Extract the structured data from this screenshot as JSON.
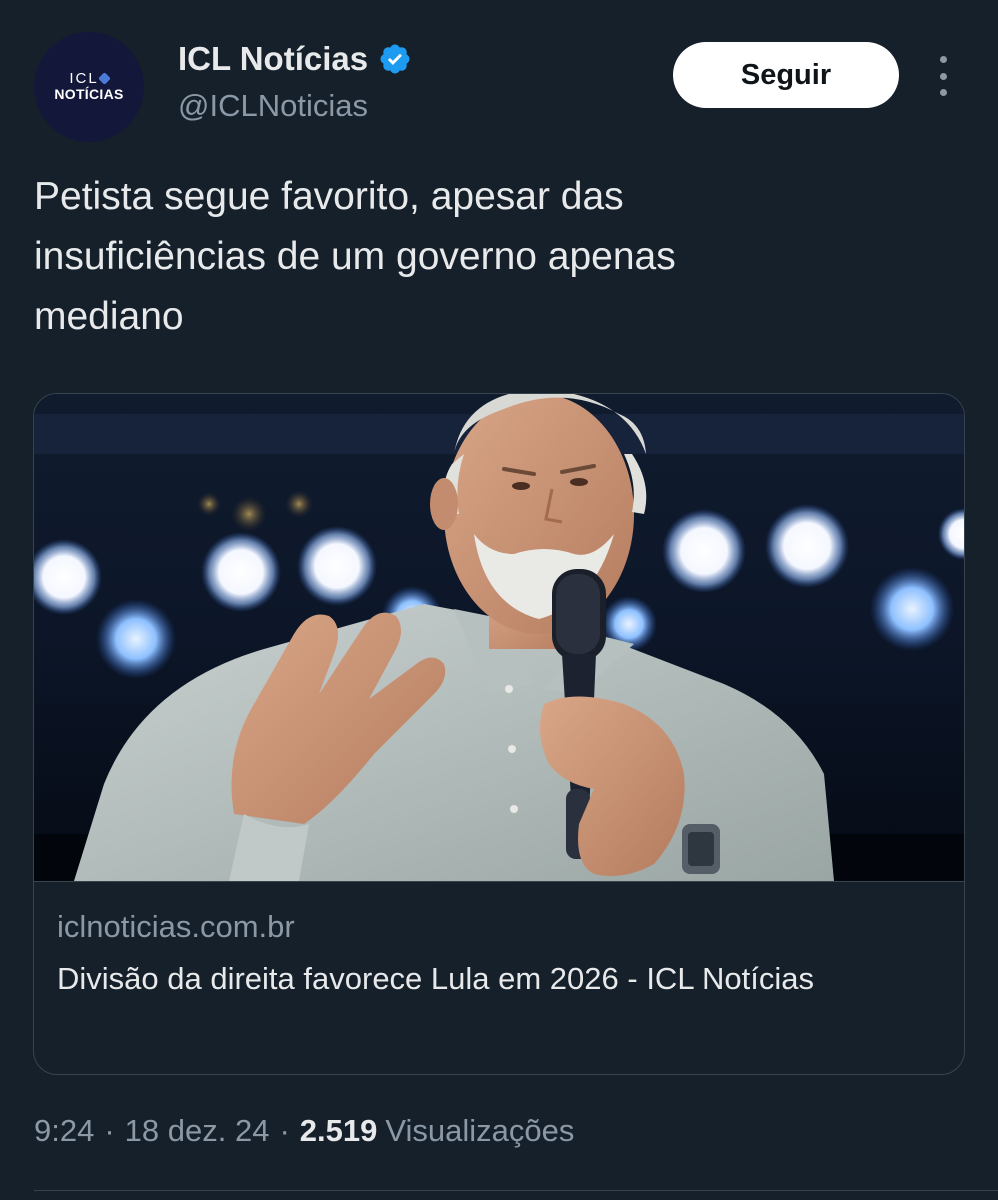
{
  "account": {
    "avatar_logo_top": "ICL",
    "avatar_logo_bottom": "NOTÍCIAS",
    "display_name": "ICL Notícias",
    "handle": "@ICLNoticias",
    "verified_icon": "verified-badge-icon",
    "verified_color": "#1d9bf0"
  },
  "actions": {
    "follow_label": "Seguir",
    "more_icon": "more-vertical-icon"
  },
  "tweet": {
    "text": "Petista segue favorito, apesar das\ninsuficiências de um governo apenas\nmediano"
  },
  "card": {
    "domain": "iclnoticias.com.br",
    "title": "Divisão da direita favorece Lula em 2026 - ICL Notícias"
  },
  "meta": {
    "time": "9:24",
    "date": "18 dez. 24",
    "separator": "·",
    "views_count": "2.519",
    "views_label": "Visualizações"
  },
  "colors": {
    "background": "#15202b",
    "primary_text": "#e7e9ea",
    "secondary_text": "#8b98a5",
    "border": "#38444d"
  }
}
